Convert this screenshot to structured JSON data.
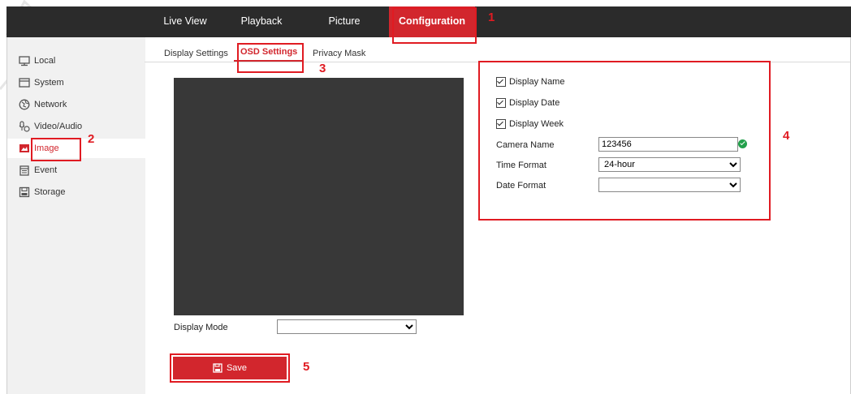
{
  "top_nav": {
    "tabs": [
      {
        "label": "Live View"
      },
      {
        "label": "Playback"
      },
      {
        "label": "Picture"
      },
      {
        "label": "Configuration",
        "active": true
      }
    ]
  },
  "sidebar": {
    "items": [
      {
        "label": "Local",
        "icon": "monitor-icon"
      },
      {
        "label": "System",
        "icon": "window-icon"
      },
      {
        "label": "Network",
        "icon": "globe-icon"
      },
      {
        "label": "Video/Audio",
        "icon": "microphone-camera-icon"
      },
      {
        "label": "Image",
        "icon": "image-icon",
        "active": true
      },
      {
        "label": "Event",
        "icon": "calendar-icon"
      },
      {
        "label": "Storage",
        "icon": "storage-icon"
      }
    ]
  },
  "sub_tabs": {
    "items": [
      {
        "label": "Display Settings"
      },
      {
        "label": "OSD Settings",
        "active": true
      },
      {
        "label": "Privacy Mask"
      }
    ]
  },
  "display_mode": {
    "label": "Display Mode",
    "value": ""
  },
  "osd": {
    "display_name": {
      "label": "Display Name",
      "checked": true
    },
    "display_date": {
      "label": "Display Date",
      "checked": true
    },
    "display_week": {
      "label": "Display Week",
      "checked": true
    },
    "camera_name": {
      "label": "Camera Name",
      "value": "123456"
    },
    "time_format": {
      "label": "Time Format",
      "value": "24-hour"
    },
    "date_format": {
      "label": "Date Format",
      "value": ""
    }
  },
  "save_button": {
    "label": "Save"
  },
  "callouts": [
    "1",
    "2",
    "3",
    "4",
    "5"
  ],
  "colors": {
    "accent": "#d2262d",
    "topbar": "#2b2b2b",
    "callout": "#e01b22",
    "preview": "#383838"
  }
}
